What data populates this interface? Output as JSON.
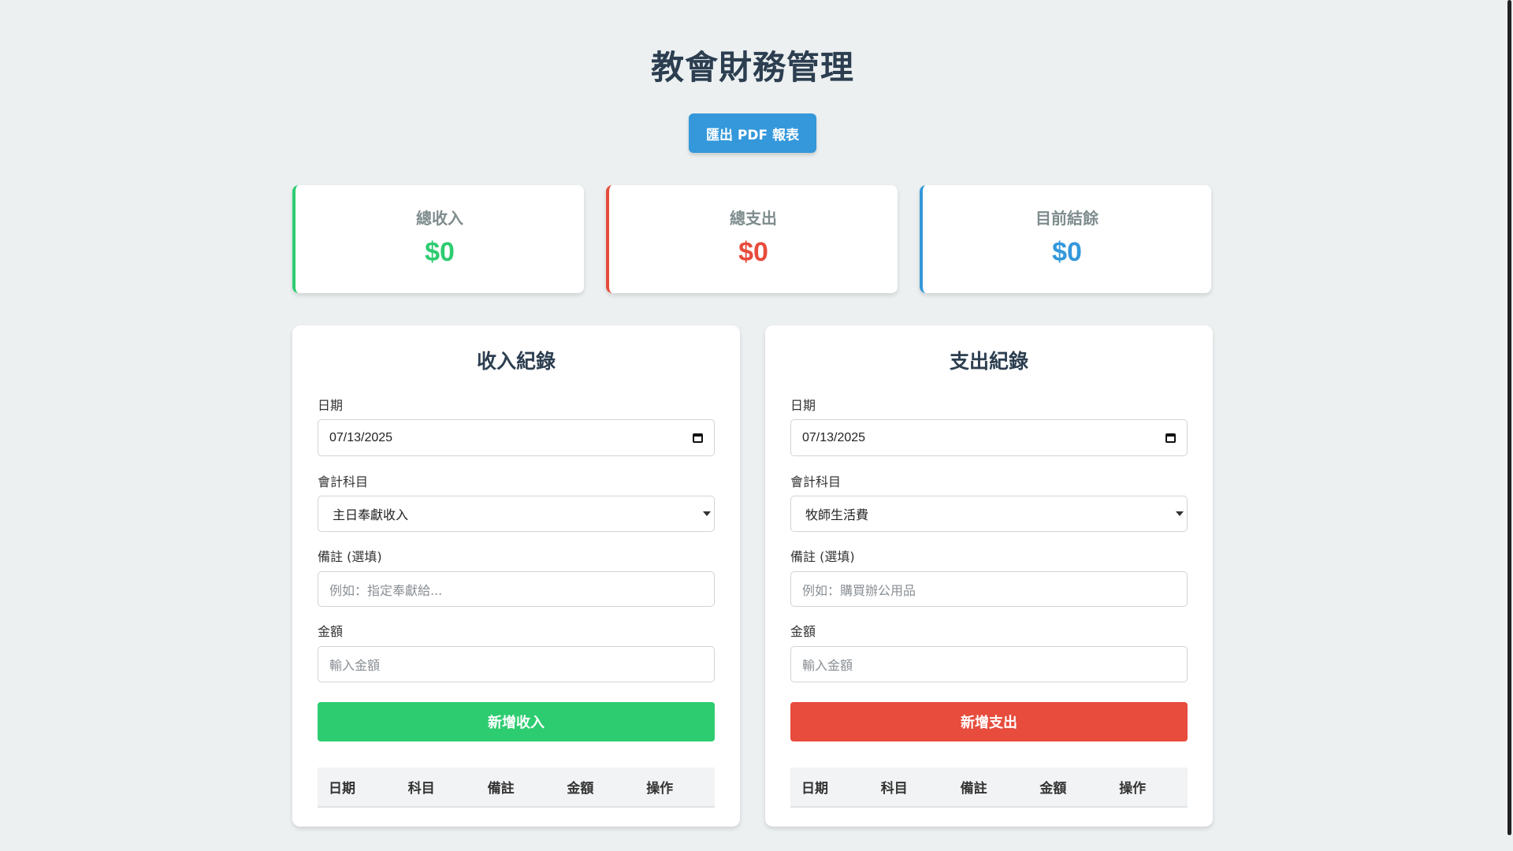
{
  "header": {
    "title": "教會財務管理",
    "export_label": "匯出 PDF 報表"
  },
  "summary": {
    "income": {
      "label": "總收入",
      "value": "$0",
      "color": "#2ecc71"
    },
    "expense": {
      "label": "總支出",
      "value": "$0",
      "color": "#e74c3c"
    },
    "balance": {
      "label": "目前結餘",
      "value": "$0",
      "color": "#3498db"
    }
  },
  "income_panel": {
    "title": "收入紀錄",
    "date_label": "日期",
    "date_value": "07/13/2025",
    "account_label": "會計科目",
    "account_value": "主日奉獻收入",
    "note_label": "備註 (選填)",
    "note_placeholder": "例如：指定奉獻給...",
    "amount_label": "金額",
    "amount_placeholder": "輸入金額",
    "submit_label": "新增收入",
    "button_color": "#2ecc71",
    "columns": [
      "日期",
      "科目",
      "備註",
      "金額",
      "操作"
    ]
  },
  "expense_panel": {
    "title": "支出紀錄",
    "date_label": "日期",
    "date_value": "07/13/2025",
    "account_label": "會計科目",
    "account_value": "牧師生活費",
    "note_label": "備註 (選填)",
    "note_placeholder": "例如：購買辦公用品",
    "amount_label": "金額",
    "amount_placeholder": "輸入金額",
    "submit_label": "新增支出",
    "button_color": "#e74c3c",
    "columns": [
      "日期",
      "科目",
      "備註",
      "金額",
      "操作"
    ]
  }
}
